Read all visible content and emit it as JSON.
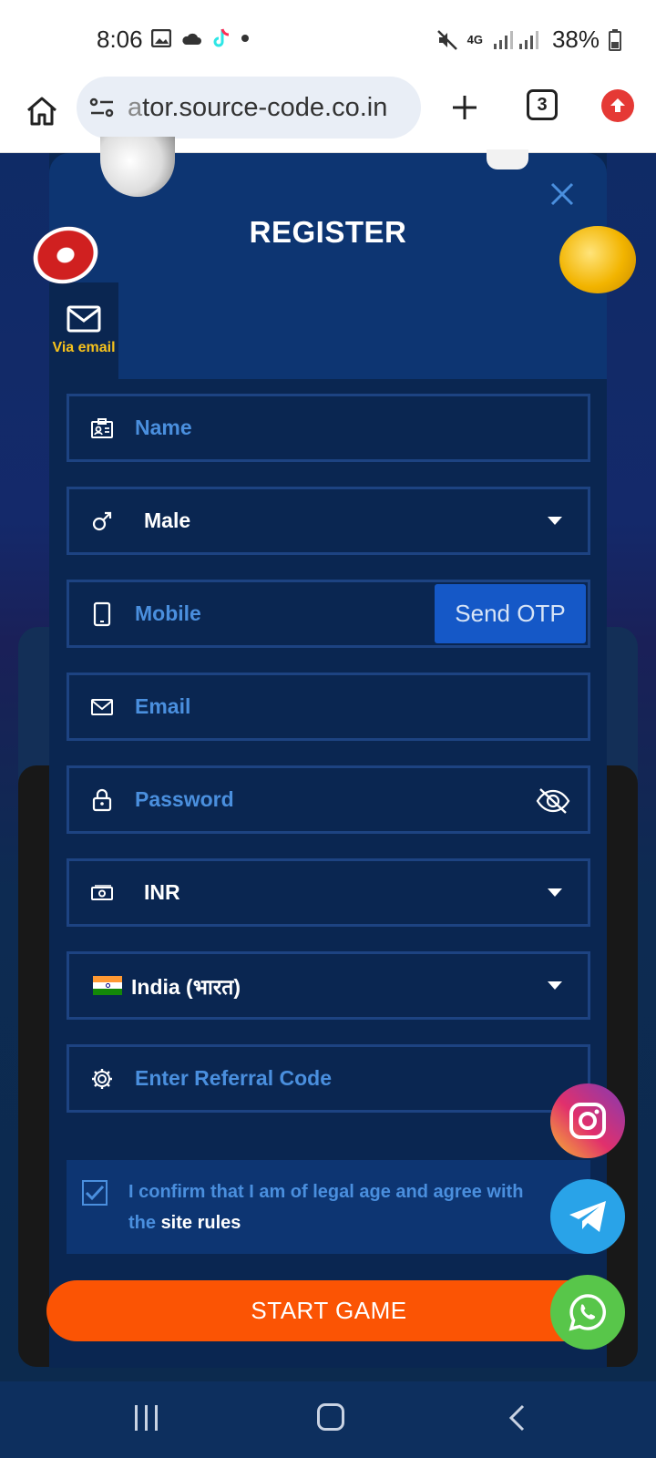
{
  "status_bar": {
    "time": "8:06",
    "network": "4G",
    "battery": "38%"
  },
  "browser": {
    "url_prefix": "a",
    "url": "tor.source-code.co.in",
    "tab_count": "3"
  },
  "modal": {
    "title": "REGISTER",
    "tab_via_email": "Via email",
    "fields": {
      "name_placeholder": "Name",
      "gender_value": "Male",
      "mobile_placeholder": "Mobile",
      "send_otp_label": "Send OTP",
      "email_placeholder": "Email",
      "password_placeholder": "Password",
      "currency_value": "INR",
      "country_value": "India (भारत)",
      "referral_placeholder": "Enter Referral Code"
    },
    "agree": {
      "text": "I confirm that I am of legal age and agree with the ",
      "link": "site rules",
      "checked": true
    },
    "start_button": "START GAME"
  },
  "colors": {
    "accent_orange": "#fb5404",
    "link_blue": "#4a8fde",
    "otp_blue": "#1558c7",
    "panel": "#0a2651"
  },
  "icons": [
    "home-icon",
    "site-settings-icon",
    "plus-icon",
    "tabs-icon",
    "update-icon",
    "close-icon",
    "mail-icon",
    "id-card-icon",
    "male-icon",
    "phone-icon",
    "lock-icon",
    "eye-off-icon",
    "cash-icon",
    "flag-india-icon",
    "gear-icon",
    "check-icon",
    "instagram-icon",
    "telegram-icon",
    "whatsapp-icon"
  ]
}
